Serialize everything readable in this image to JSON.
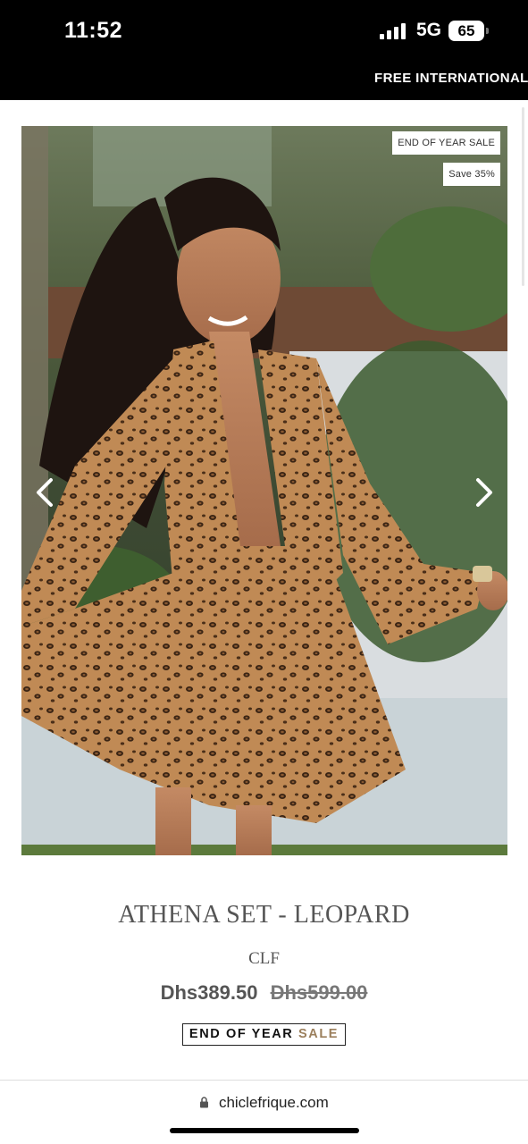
{
  "status_bar": {
    "time": "11:52",
    "network": "5G",
    "battery": "65"
  },
  "announcement": {
    "text": "FREE INTERNATIONAL"
  },
  "product": {
    "badges": {
      "sale": "END OF YEAR SALE",
      "save": "Save 35%"
    },
    "title": "ATHENA SET - LEOPARD",
    "vendor": "CLF",
    "price": "Dhs389.50",
    "compare_price": "Dhs599.00",
    "sale_label_main": "END OF YEAR",
    "sale_label_accent": "SALE"
  },
  "browser": {
    "url": "chiclefrique.com"
  },
  "icons": {
    "left": "chevron-left-icon",
    "right": "chevron-right-icon",
    "lock": "lock-icon",
    "signal": "signal-icon",
    "battery": "battery-icon"
  },
  "colors": {
    "accent": "#9b7f5c",
    "bar": "#000000"
  }
}
